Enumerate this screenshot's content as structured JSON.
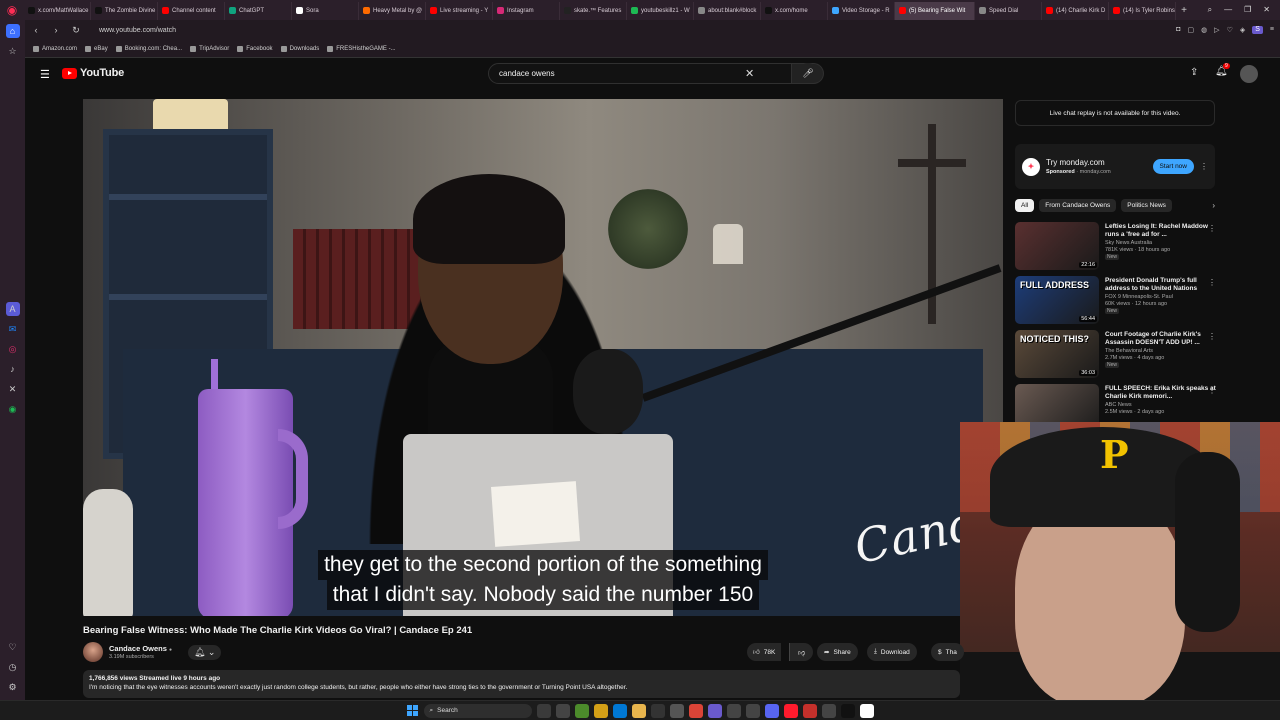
{
  "browser": {
    "tabs": [
      {
        "label": "x.com/MattWallace",
        "color": "#111111"
      },
      {
        "label": "The Zombie Divine",
        "color": "#111111"
      },
      {
        "label": "Channel content",
        "color": "#ff0000"
      },
      {
        "label": "ChatGPT",
        "color": "#10a37f"
      },
      {
        "label": "Sora",
        "color": "#ffffff"
      },
      {
        "label": "Heavy Metal by @",
        "color": "#ff6a00"
      },
      {
        "label": "Live streaming - Y",
        "color": "#ff0000"
      },
      {
        "label": "Instagram",
        "color": "#d62976"
      },
      {
        "label": "skate.™ Features",
        "color": "#222222"
      },
      {
        "label": "youtubeskillz1 - W",
        "color": "#1db954"
      },
      {
        "label": "about:blank#block",
        "color": "#888888"
      },
      {
        "label": "x.com/home",
        "color": "#111111"
      },
      {
        "label": "Video Storage - R",
        "color": "#3ea6ff"
      },
      {
        "label": "(5) Bearing False Wit",
        "color": "#ff0000",
        "active": true
      },
      {
        "label": "Speed Dial",
        "color": "#888888"
      },
      {
        "label": "(14) Charlie Kirk D",
        "color": "#ff0000"
      },
      {
        "label": "(14) Is Tyler Robins",
        "color": "#ff0000"
      }
    ],
    "new_tab": "+",
    "url": "www.youtube.com/watch",
    "bookmarks": [
      "Amazon.com",
      "eBay",
      "Booking.com: Chea...",
      "TripAdvisor",
      "Facebook",
      "Downloads",
      "FRESHistheGAME -..."
    ],
    "extension_badge": "S"
  },
  "youtube": {
    "logo_text": "YouTube",
    "search_value": "candace owens",
    "notification_count": "9",
    "captions": [
      "they get to the second portion of the something",
      "that I didn't say. Nobody said the number 150"
    ],
    "overlay_signature": "Candace",
    "video_title": "Bearing False Witness: Who Made The Charlie Kirk Videos Go Viral? | Candace Ep 241",
    "channel": {
      "name": "Candace Owens",
      "verified": "●",
      "subscribers": "3.19M subscribers"
    },
    "actions": {
      "likes": "78K",
      "share": "Share",
      "download": "Download",
      "thanks": "Tha"
    },
    "description": {
      "stats": "1,766,856 views  Streamed live 9 hours ago",
      "text": "I'm noticing that the eye witnesses accounts weren't exactly just random college students, but rather, people who either have strong ties to the government or Turning Point USA altogether."
    },
    "chat_note": "Live chat replay is not available for this video.",
    "ad": {
      "title": "Try monday.com",
      "sponsored": "Sponsored",
      "domain": "monday.com",
      "cta": "Start now"
    },
    "chips": [
      {
        "label": "All",
        "selected": true
      },
      {
        "label": "From Candace Owens",
        "selected": false
      },
      {
        "label": "Politics News",
        "selected": false
      }
    ],
    "recommendations": [
      {
        "title": "Lefties Losing It: Rachel Maddow runs a 'free ad for ...",
        "channel": "Sky News Australia",
        "meta": "781K views · 18 hours ago",
        "badge": "New",
        "duration": "22:16",
        "thumb_text": "",
        "thumb_color": "#5a3030"
      },
      {
        "title": "President Donald Trump's full address to the United Nations",
        "channel": "FOX 9 Minneapolis-St. Paul",
        "meta": "60K views · 12 hours ago",
        "badge": "New",
        "duration": "56:44",
        "thumb_text": "FULL ADDRESS",
        "thumb_color": "#1d3d7a"
      },
      {
        "title": "Court Footage of Charlie Kirk's Assassin DOESN'T ADD UP! ...",
        "channel": "The Behavioral Arts",
        "meta": "2.7M views · 4 days ago",
        "badge": "New",
        "duration": "36:03",
        "thumb_text": "NOTICED THIS?",
        "thumb_color": "#5b4a3a"
      },
      {
        "title": "FULL SPEECH: Erika Kirk speaks at Charlie Kirk memori...",
        "channel": "ABC News",
        "meta": "2.5M views · 2 days ago",
        "badge": "",
        "duration": "",
        "thumb_text": "",
        "thumb_color": "#6a5a52"
      }
    ]
  },
  "taskbar": {
    "search_label": "Search",
    "apps": [
      {
        "name": "app-1",
        "color": "#3a3a3a"
      },
      {
        "name": "app-2",
        "color": "#444444"
      },
      {
        "name": "app-3",
        "color": "#4c8b2b"
      },
      {
        "name": "app-4",
        "color": "#d4a017"
      },
      {
        "name": "app-5",
        "color": "#0078d4"
      },
      {
        "name": "app-6",
        "color": "#e8b54d"
      },
      {
        "name": "app-7",
        "color": "#333333"
      },
      {
        "name": "app-8",
        "color": "#555555"
      },
      {
        "name": "app-9",
        "color": "#db4437"
      },
      {
        "name": "app-10",
        "color": "#6a5acd"
      },
      {
        "name": "app-11",
        "color": "#444444"
      },
      {
        "name": "app-12",
        "color": "#444444"
      },
      {
        "name": "app-13",
        "color": "#5865f2"
      },
      {
        "name": "app-14",
        "color": "#ff1b2d"
      },
      {
        "name": "app-15",
        "color": "#c4302b"
      },
      {
        "name": "app-16",
        "color": "#444444"
      },
      {
        "name": "app-17",
        "color": "#111111"
      },
      {
        "name": "app-18",
        "color": "#ffffff"
      }
    ]
  }
}
